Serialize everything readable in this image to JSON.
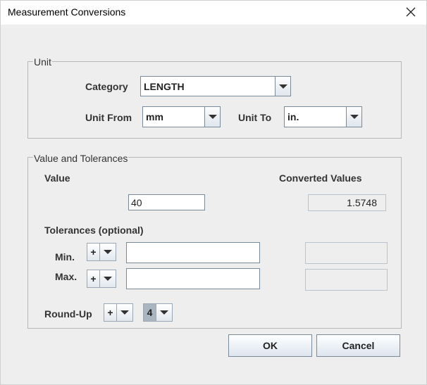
{
  "window": {
    "title": "Measurement Conversions"
  },
  "unit_group": {
    "legend": "Unit",
    "category_label": "Category",
    "category_value": "LENGTH",
    "unit_from_label": "Unit From",
    "unit_from_value": "mm",
    "unit_to_label": "Unit To",
    "unit_to_value": "in."
  },
  "value_group": {
    "legend": "Value and Tolerances",
    "value_label": "Value",
    "converted_label": "Converted Values",
    "value_input": "40",
    "converted_value": "1.5748",
    "tolerances_label": "Tolerances (optional)",
    "min_label": "Min.",
    "min_sign": "+",
    "min_input": "",
    "min_converted": "",
    "max_label": "Max.",
    "max_sign": "+",
    "max_input": "",
    "max_converted": "",
    "roundup_label": "Round-Up",
    "roundup_sign": "+",
    "roundup_digits": "4"
  },
  "buttons": {
    "ok": "OK",
    "cancel": "Cancel"
  }
}
